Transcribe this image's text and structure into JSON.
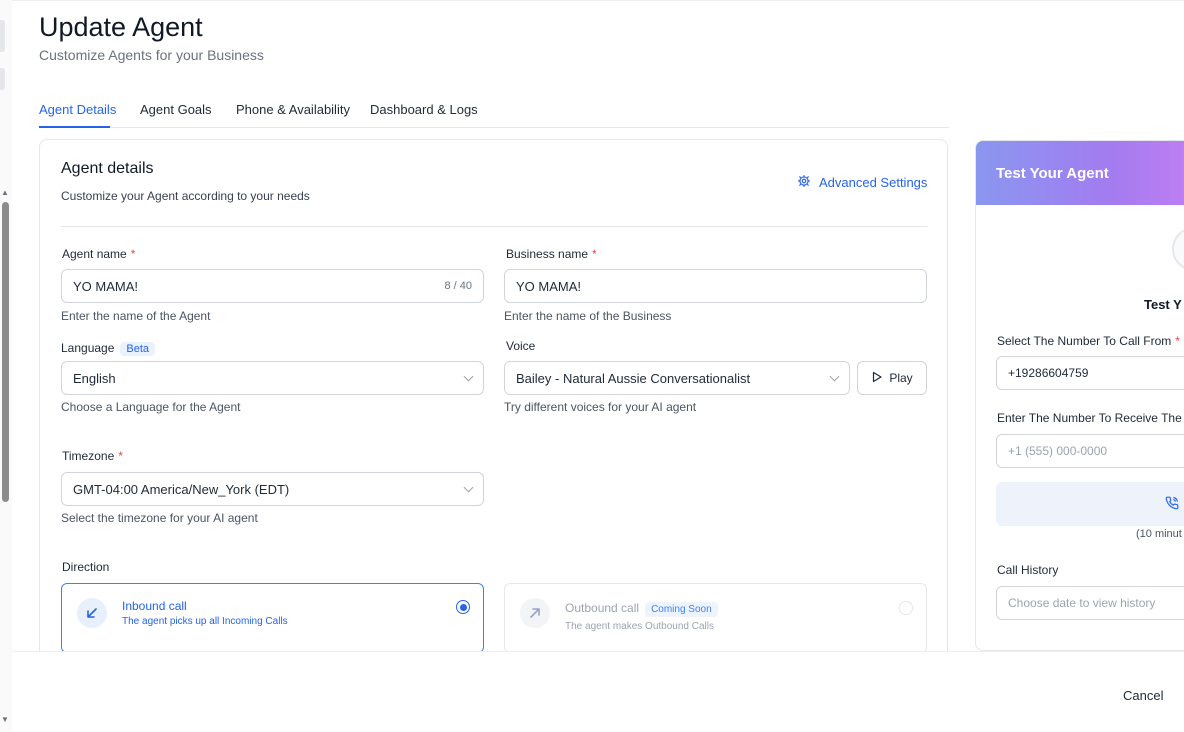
{
  "header": {
    "title": "Update Agent",
    "subtitle": "Customize Agents for your Business"
  },
  "tabs": [
    {
      "label": "Agent Details",
      "active": true
    },
    {
      "label": "Agent Goals"
    },
    {
      "label": "Phone & Availability"
    },
    {
      "label": "Dashboard & Logs"
    }
  ],
  "details": {
    "title": "Agent details",
    "subtitle": "Customize your Agent according to your needs",
    "advanced_settings": "Advanced Settings",
    "agent_name": {
      "label": "Agent name",
      "required_mark": "*",
      "value": "YO MAMA!",
      "counter": "8 / 40",
      "hint": "Enter the name of the Agent"
    },
    "business_name": {
      "label": "Business name",
      "required_mark": "*",
      "value": "YO MAMA!",
      "hint": "Enter the name of the Business"
    },
    "language": {
      "label": "Language",
      "badge": "Beta",
      "value": "English",
      "hint": "Choose a Language for the Agent"
    },
    "voice": {
      "label": "Voice",
      "value": "Bailey - Natural Aussie Conversationalist",
      "play_label": "Play",
      "hint": "Try different voices for your AI agent"
    },
    "timezone": {
      "label": "Timezone",
      "required_mark": "*",
      "value": "GMT-04:00 America/New_York (EDT)",
      "hint": "Select the timezone for your AI agent"
    },
    "direction": {
      "label": "Direction",
      "inbound": {
        "title": "Inbound call",
        "desc": "The agent picks up all Incoming Calls",
        "selected": true
      },
      "outbound": {
        "title": "Outbound call",
        "badge": "Coming Soon",
        "desc": "The agent makes Outbound Calls",
        "disabled": true
      }
    }
  },
  "test_panel": {
    "title": "Test Your Agent",
    "name_partial": "Test Y",
    "from_label": "Select The Number To Call From",
    "required_mark": "*",
    "from_value": "+19286604759",
    "receive_label": "Enter The Number To Receive The C",
    "receive_placeholder": "+1 (555) 000-0000",
    "minutes_note": "(10 minut",
    "history_label": "Call History",
    "history_placeholder": "Choose date to view history"
  },
  "footer": {
    "cancel_label": "Cancel"
  },
  "colors": {
    "accent": "#2563eb",
    "required": "#ef4444",
    "header_gradient_start": "#8a97ef",
    "header_gradient_end": "#c07ef2"
  }
}
